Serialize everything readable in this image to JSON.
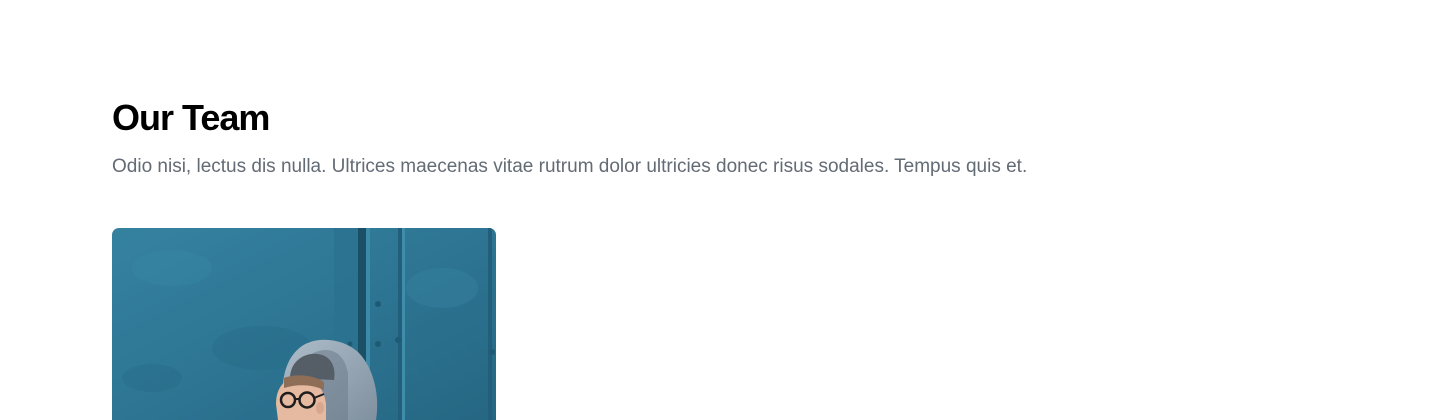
{
  "team": {
    "title": "Our Team",
    "description": "Odio nisi, lectus dis nulla. Ultrices maecenas vitae rutrum dolor ultricies donec risus sodales. Tempus quis et."
  },
  "colors": {
    "heading": "#000000",
    "body_text": "#636b75",
    "photo_wall": "#2f7896"
  },
  "members": [
    {
      "photo": "member-photo"
    }
  ]
}
